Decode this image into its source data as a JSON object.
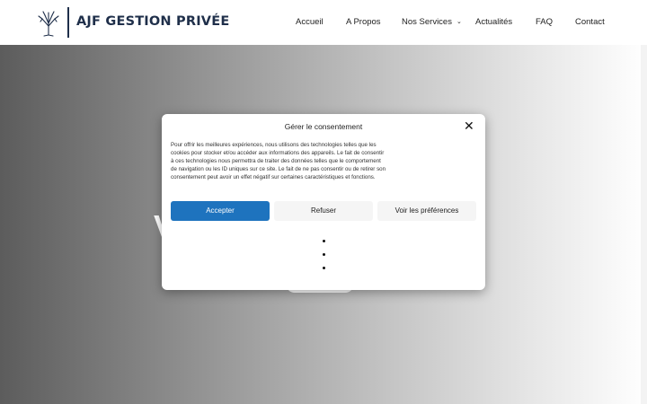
{
  "header": {
    "brand": "AJF GESTION PRIVÉE",
    "nav": [
      {
        "label": "Accueil"
      },
      {
        "label": "A Propos"
      },
      {
        "label": "Nos Services",
        "has_dropdown": true
      },
      {
        "label": "Actualités"
      },
      {
        "label": "FAQ"
      },
      {
        "label": "Contact"
      }
    ],
    "dropdown_chevron": "⌄",
    "logo_icon": "tree-icon"
  },
  "hero": {
    "partial_letter": "V"
  },
  "consent": {
    "title": "Gérer le consentement",
    "close_glyph": "✕",
    "body": "Pour offrir les meilleures expériences, nous utilisons des technologies telles que les cookies pour stocker et/ou accéder aux informations des appareils. Le fait de consentir à ces technologies nous permettra de traiter des données telles que le comportement de navigation ou les ID uniques sur ce site. Le fait de ne pas consentir ou de retirer son consentement peut avoir un effet négatif sur certaines caractéristiques et fonctions.",
    "accept_label": "Accepter",
    "refuse_label": "Refuser",
    "prefs_label": "Voir les préférences",
    "list_items": [
      "",
      "",
      ""
    ]
  },
  "colors": {
    "brand_navy": "#1f2f4a",
    "accept_blue": "#1e73be"
  }
}
